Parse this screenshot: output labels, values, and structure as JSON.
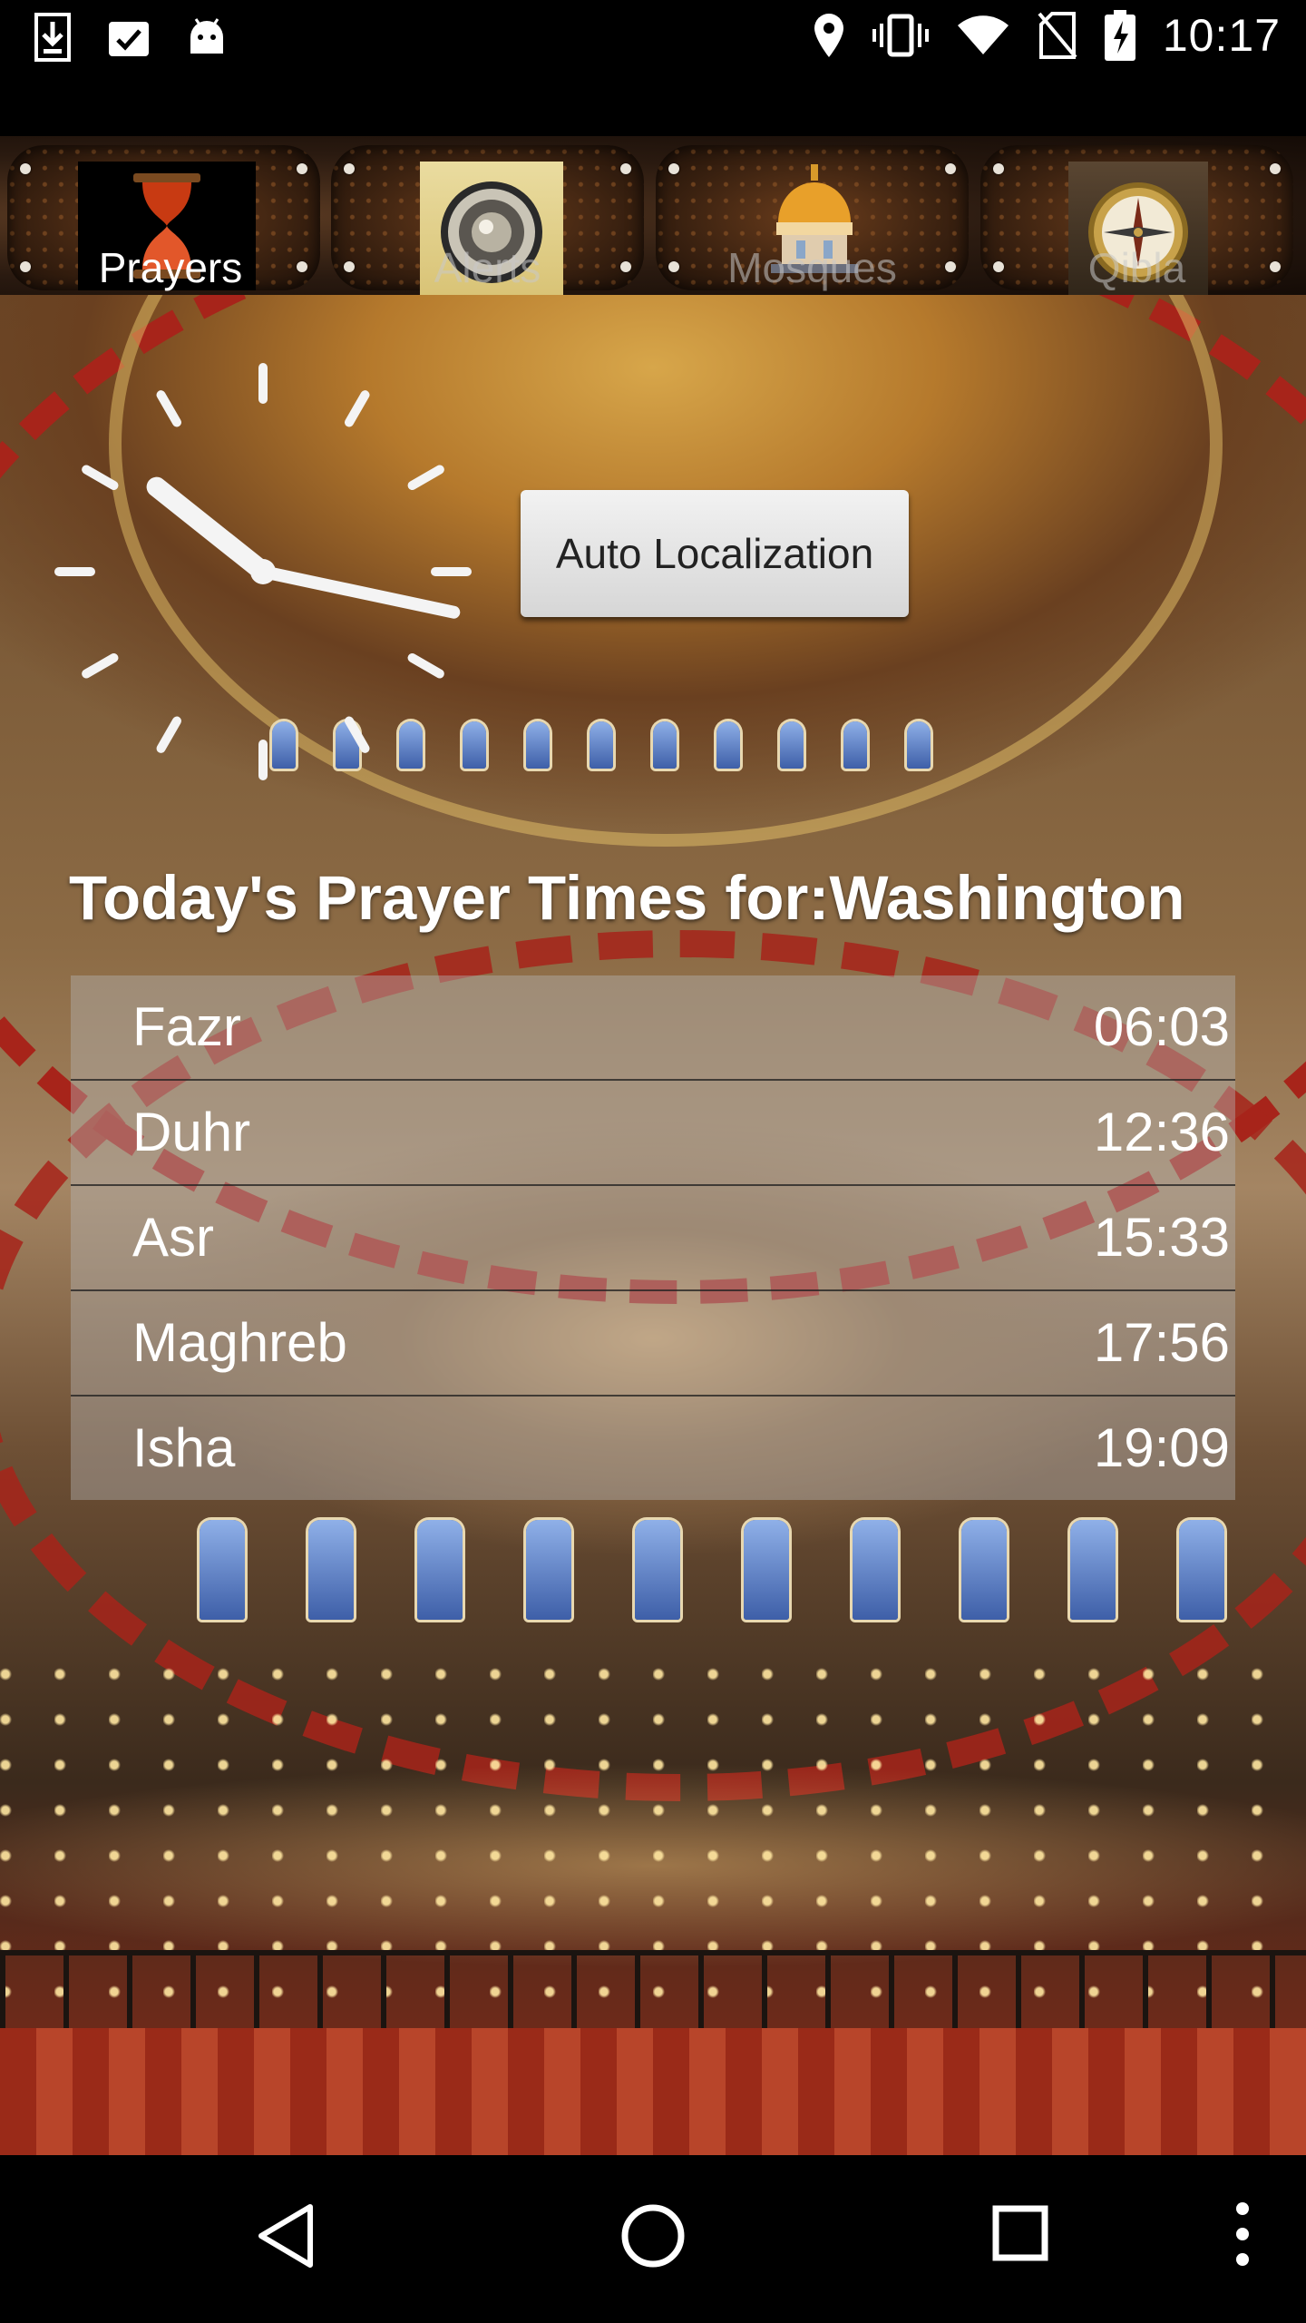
{
  "status_bar": {
    "time": "10:17",
    "left_icons": [
      "download-icon",
      "clipboard-check-icon",
      "android-icon"
    ],
    "right_icons": [
      "location-icon",
      "vibrate-icon",
      "wifi-icon",
      "no-sim-icon",
      "battery-charging-icon"
    ]
  },
  "tabs": [
    {
      "label": "Prayers",
      "icon": "hourglass-icon",
      "active": true
    },
    {
      "label": "Alerts",
      "icon": "speaker-icon",
      "active": false
    },
    {
      "label": "Mosques",
      "icon": "mosque-icon",
      "active": false
    },
    {
      "label": "Qibla",
      "icon": "compass-icon",
      "active": false
    }
  ],
  "clock": {
    "hour": 10,
    "minute": 17
  },
  "auto_localization_label": "Auto Localization",
  "title": "Today's Prayer Times for:Washington",
  "prayers": [
    {
      "name": "Fazr",
      "time": "06:03"
    },
    {
      "name": "Duhr",
      "time": "12:36"
    },
    {
      "name": "Asr",
      "time": "15:33"
    },
    {
      "name": "Maghreb",
      "time": "17:56"
    },
    {
      "name": "Isha",
      "time": "19:09"
    }
  ],
  "nav": [
    "back-icon",
    "home-icon",
    "recents-icon",
    "overflow-menu-icon"
  ]
}
